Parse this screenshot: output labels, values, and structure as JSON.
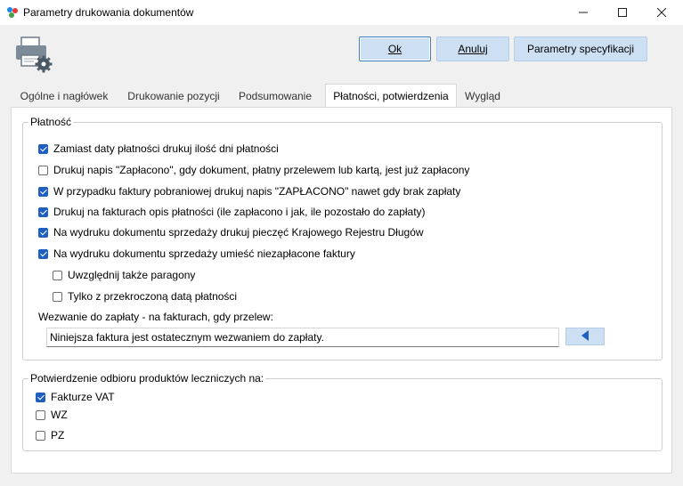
{
  "window": {
    "title": "Parametry drukowania dokumentów"
  },
  "buttons": {
    "ok": "Ok",
    "cancel": "Anuluj",
    "spec": "Parametry specyfikacji"
  },
  "tabs": [
    {
      "label": "Ogólne i nagłówek"
    },
    {
      "label": "Drukowanie pozycji"
    },
    {
      "label": "Podsumowanie"
    },
    {
      "label": "Płatności, potwierdzenia"
    },
    {
      "label": "Wygląd"
    }
  ],
  "payment": {
    "legend": "Płatność",
    "options": [
      {
        "label": "Zamiast daty płatności drukuj ilość dni płatności",
        "checked": true
      },
      {
        "label": "Drukuj napis \"Zapłacono\", gdy dokument, płatny przelewem lub kartą, jest już zapłacony",
        "checked": false
      },
      {
        "label": "W przypadku faktury pobraniowej drukuj napis \"ZAPŁACONO\" nawet gdy brak zapłaty",
        "checked": true
      },
      {
        "label": "Drukuj na fakturach opis płatności (ile zapłacono i jak, ile pozostało do zapłaty)",
        "checked": true
      },
      {
        "label": "Na wydruku dokumentu sprzedaży drukuj pieczęć Krajowego Rejestru Długów",
        "checked": true
      },
      {
        "label": "Na wydruku dokumentu sprzedaży umieść niezapłacone faktury",
        "checked": true
      }
    ],
    "sub_options": [
      {
        "label": "Uwzględnij także paragony",
        "checked": false
      },
      {
        "label": "Tylko z przekroczoną datą płatności",
        "checked": false
      }
    ],
    "reminder_label": "Wezwanie do zapłaty - na fakturach, gdy przelew:",
    "reminder_value": "Niniejsza faktura jest ostatecznym wezwaniem do zapłaty."
  },
  "confirmation": {
    "legend": "Potwierdzenie odbioru produktów leczniczych na:",
    "options": [
      {
        "label": "Fakturze VAT",
        "checked": true
      },
      {
        "label": "WZ",
        "checked": false
      },
      {
        "label": "PZ",
        "checked": false
      }
    ]
  },
  "colors": {
    "accent": "#1f5fbf",
    "button_bg": "#cddff2"
  },
  "icons": [
    "app-icon",
    "printer-settings-icon",
    "minimize-icon",
    "maximize-icon",
    "close-icon",
    "arrow-left-icon"
  ]
}
